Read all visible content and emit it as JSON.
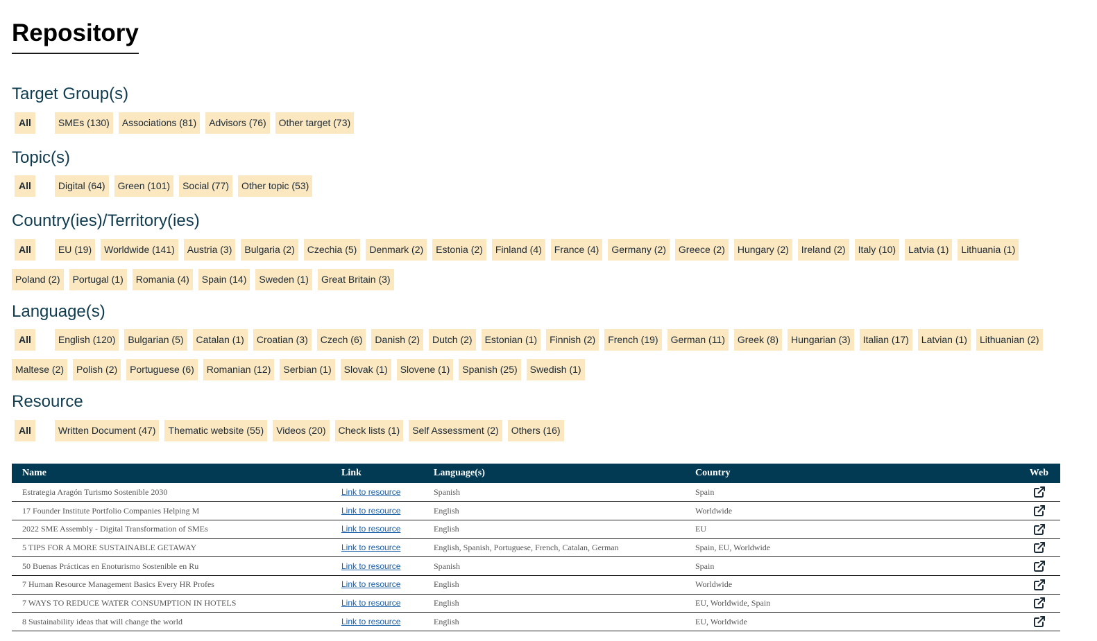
{
  "page": {
    "title": "Repository"
  },
  "sections": {
    "target": {
      "title": "Target Group(s)",
      "all_label": "All",
      "chips": [
        "SMEs (130)",
        "Associations (81)",
        "Advisors (76)",
        "Other target (73)"
      ]
    },
    "topic": {
      "title": "Topic(s)",
      "all_label": "All",
      "chips": [
        "Digital (64)",
        "Green (101)",
        "Social (77)",
        "Other topic (53)"
      ]
    },
    "country": {
      "title": "Country(ies)/Territory(ies)",
      "all_label": "All",
      "chips_row1": [
        "EU (19)",
        "Worldwide (141)",
        "Austria (3)",
        "Bulgaria (2)",
        "Czechia (5)",
        "Denmark (2)",
        "Estonia (2)",
        "Finland (4)",
        "France (4)",
        "Germany (2)",
        "Greece (2)",
        "Hungary (2)",
        "Ireland (2)",
        "Italy (10)",
        "Latvia (1)",
        "Lithuania (1)"
      ],
      "chips_row2": [
        "Poland (2)",
        "Portugal (1)",
        "Romania (4)",
        "Spain (14)",
        "Sweden (1)",
        "Great Britain (3)"
      ]
    },
    "language": {
      "title": "Language(s)",
      "all_label": "All",
      "chips_row1": [
        "English (120)",
        "Bulgarian (5)",
        "Catalan (1)",
        "Croatian (3)",
        "Czech (6)",
        "Danish (2)",
        "Dutch (2)",
        "Estonian (1)",
        "Finnish (2)",
        "French (19)",
        "German (11)",
        "Greek (8)",
        "Hungarian (3)",
        "Italian (17)",
        "Latvian (1)",
        "Lithuanian (2)"
      ],
      "chips_row2": [
        "Maltese (2)",
        "Polish (2)",
        "Portuguese (6)",
        "Romanian (12)",
        "Serbian (1)",
        "Slovak (1)",
        "Slovene (1)",
        "Spanish (25)",
        "Swedish (1)"
      ]
    },
    "resource": {
      "title": "Resource",
      "all_label": "All",
      "chips": [
        "Written Document (47)",
        "Thematic website (55)",
        "Videos (20)",
        "Check lists (1)",
        "Self Assessment (2)",
        "Others (16)"
      ]
    }
  },
  "table": {
    "headers": {
      "name": "Name",
      "link": "Link",
      "languages": "Language(s)",
      "country": "Country",
      "web": "Web"
    },
    "rows": [
      {
        "name": "Estrategia Aragón Turismo Sostenible 2030",
        "link": "Link to resource",
        "languages": "Spanish",
        "country": "Spain"
      },
      {
        "name": "17 Founder Institute Portfolio Companies Helping M",
        "link": "Link to resource",
        "languages": "English",
        "country": "Worldwide"
      },
      {
        "name": "2022 SME Assembly - Digital Transformation of SMEs",
        "link": "Link to resource",
        "languages": "English",
        "country": "EU"
      },
      {
        "name": "5 TIPS FOR A MORE SUSTAINABLE GETAWAY",
        "link": "Link to resource",
        "languages": "English, Spanish, Portuguese, French, Catalan, German",
        "country": "Spain, EU, Worldwide"
      },
      {
        "name": "50 Buenas Prácticas en Enoturismo Sostenible en Ru",
        "link": "Link to resource",
        "languages": "Spanish",
        "country": "Spain"
      },
      {
        "name": "7 Human Resource Management Basics Every HR Profes",
        "link": "Link to resource",
        "languages": "English",
        "country": "Worldwide"
      },
      {
        "name": "7 WAYS TO REDUCE WATER CONSUMPTION IN HOTELS",
        "link": "Link to resource",
        "languages": "English",
        "country": "EU, Worldwide, Spain"
      },
      {
        "name": "8 Sustainability ideas that will change the world",
        "link": "Link to resource",
        "languages": "English",
        "country": "EU, Worldwide"
      }
    ]
  },
  "icons": {
    "web": "external-link-icon"
  },
  "colors": {
    "chip_bg": "#fbe7c0",
    "header_bg": "#013a52",
    "section_title": "#0f3b4f",
    "link": "#1a5fa8"
  }
}
